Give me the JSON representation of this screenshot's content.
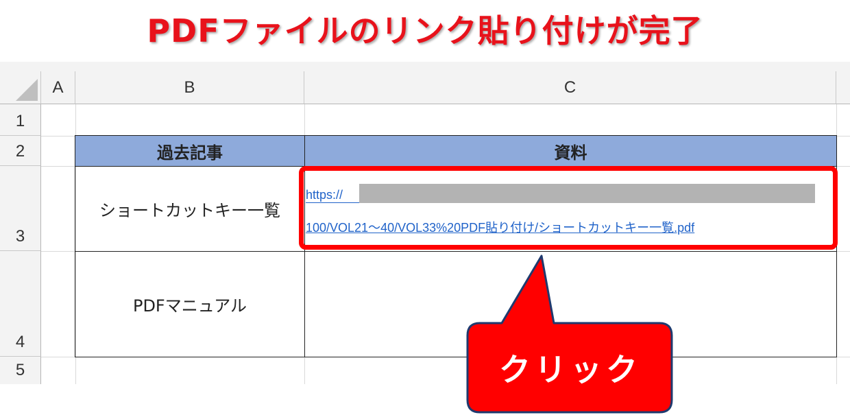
{
  "title": "PDFファイルのリンク貼り付けが完了",
  "spreadsheet": {
    "columns": [
      "A",
      "B",
      "C"
    ],
    "rows": [
      "1",
      "2",
      "3",
      "4",
      "5"
    ],
    "table": {
      "headers": [
        "過去記事",
        "資料"
      ],
      "rows": [
        {
          "article": "ショートカットキー一覧",
          "link_line1": "https://",
          "link_line2": "100/VOL21～40/VOL33%20PDF貼り付け/ショートカットキー一覧.pdf"
        },
        {
          "article": "PDFマニュアル",
          "link_line1": "",
          "link_line2": ""
        }
      ]
    }
  },
  "callout": {
    "label": "クリック"
  },
  "colors": {
    "title": "#e8121b",
    "header_fill": "#8eaadb",
    "highlight": "#ff0000",
    "link": "#1f62c9",
    "callout_fill": "#ff0000",
    "callout_border": "#1f3a6e"
  }
}
